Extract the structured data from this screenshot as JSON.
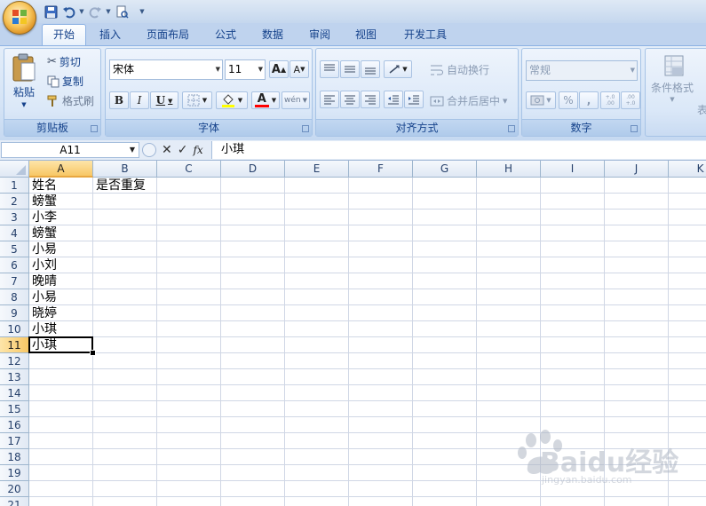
{
  "colors": {
    "accent": "#15428b",
    "selected_header": "#f8c765",
    "gridline": "#d0d7e5"
  },
  "tabs": [
    {
      "label": "开始",
      "active": true
    },
    {
      "label": "插入"
    },
    {
      "label": "页面布局"
    },
    {
      "label": "公式"
    },
    {
      "label": "数据"
    },
    {
      "label": "审阅"
    },
    {
      "label": "视图"
    },
    {
      "label": "开发工具"
    }
  ],
  "clipboard": {
    "paste": "粘贴",
    "cut": "剪切",
    "copy": "复制",
    "format_painter": "格式刷",
    "group_label": "剪贴板"
  },
  "font": {
    "name": "宋体",
    "size": "11",
    "grow_glyph": "A",
    "shrink_glyph": "A",
    "bold": "B",
    "italic": "I",
    "underline": "U",
    "color_glyph": "A",
    "phonetic_glyph": "wén",
    "group_label": "字体"
  },
  "alignment": {
    "wrap": "自动换行",
    "merge": "合并后居中",
    "group_label": "对齐方式"
  },
  "number": {
    "format": "常规",
    "percent": "%",
    "comma": ",",
    "inc_decimal": "+.0 .00",
    "dec_decimal": ".00 +.0",
    "group_label": "数字"
  },
  "styles": {
    "conditional": "条件格式",
    "table_partial": "表"
  },
  "formula_bar": {
    "name_box": "A11",
    "fx": "fx",
    "content": "小琪"
  },
  "columns": [
    "A",
    "B",
    "C",
    "D",
    "E",
    "F",
    "G",
    "H",
    "I",
    "J",
    "K"
  ],
  "rows": [
    "1",
    "2",
    "3",
    "4",
    "5",
    "6",
    "7",
    "8",
    "9",
    "10",
    "11",
    "12",
    "13",
    "14",
    "15",
    "16",
    "17",
    "18",
    "19",
    "20",
    "21"
  ],
  "cells": [
    {
      "ref": "A1",
      "value": "姓名"
    },
    {
      "ref": "B1",
      "value": "是否重复"
    },
    {
      "ref": "A2",
      "value": "螃蟹"
    },
    {
      "ref": "A3",
      "value": "小李"
    },
    {
      "ref": "A4",
      "value": "螃蟹"
    },
    {
      "ref": "A5",
      "value": "小易"
    },
    {
      "ref": "A6",
      "value": "小刘"
    },
    {
      "ref": "A7",
      "value": "晚晴"
    },
    {
      "ref": "A8",
      "value": "小易"
    },
    {
      "ref": "A9",
      "value": "晓婷"
    },
    {
      "ref": "A10",
      "value": "小琪"
    },
    {
      "ref": "A11",
      "value": "小琪"
    }
  ],
  "selection": {
    "column": "A",
    "row": "11"
  },
  "watermark": {
    "text": "Baidu经验",
    "sub": "jingyan.baidu.com"
  }
}
